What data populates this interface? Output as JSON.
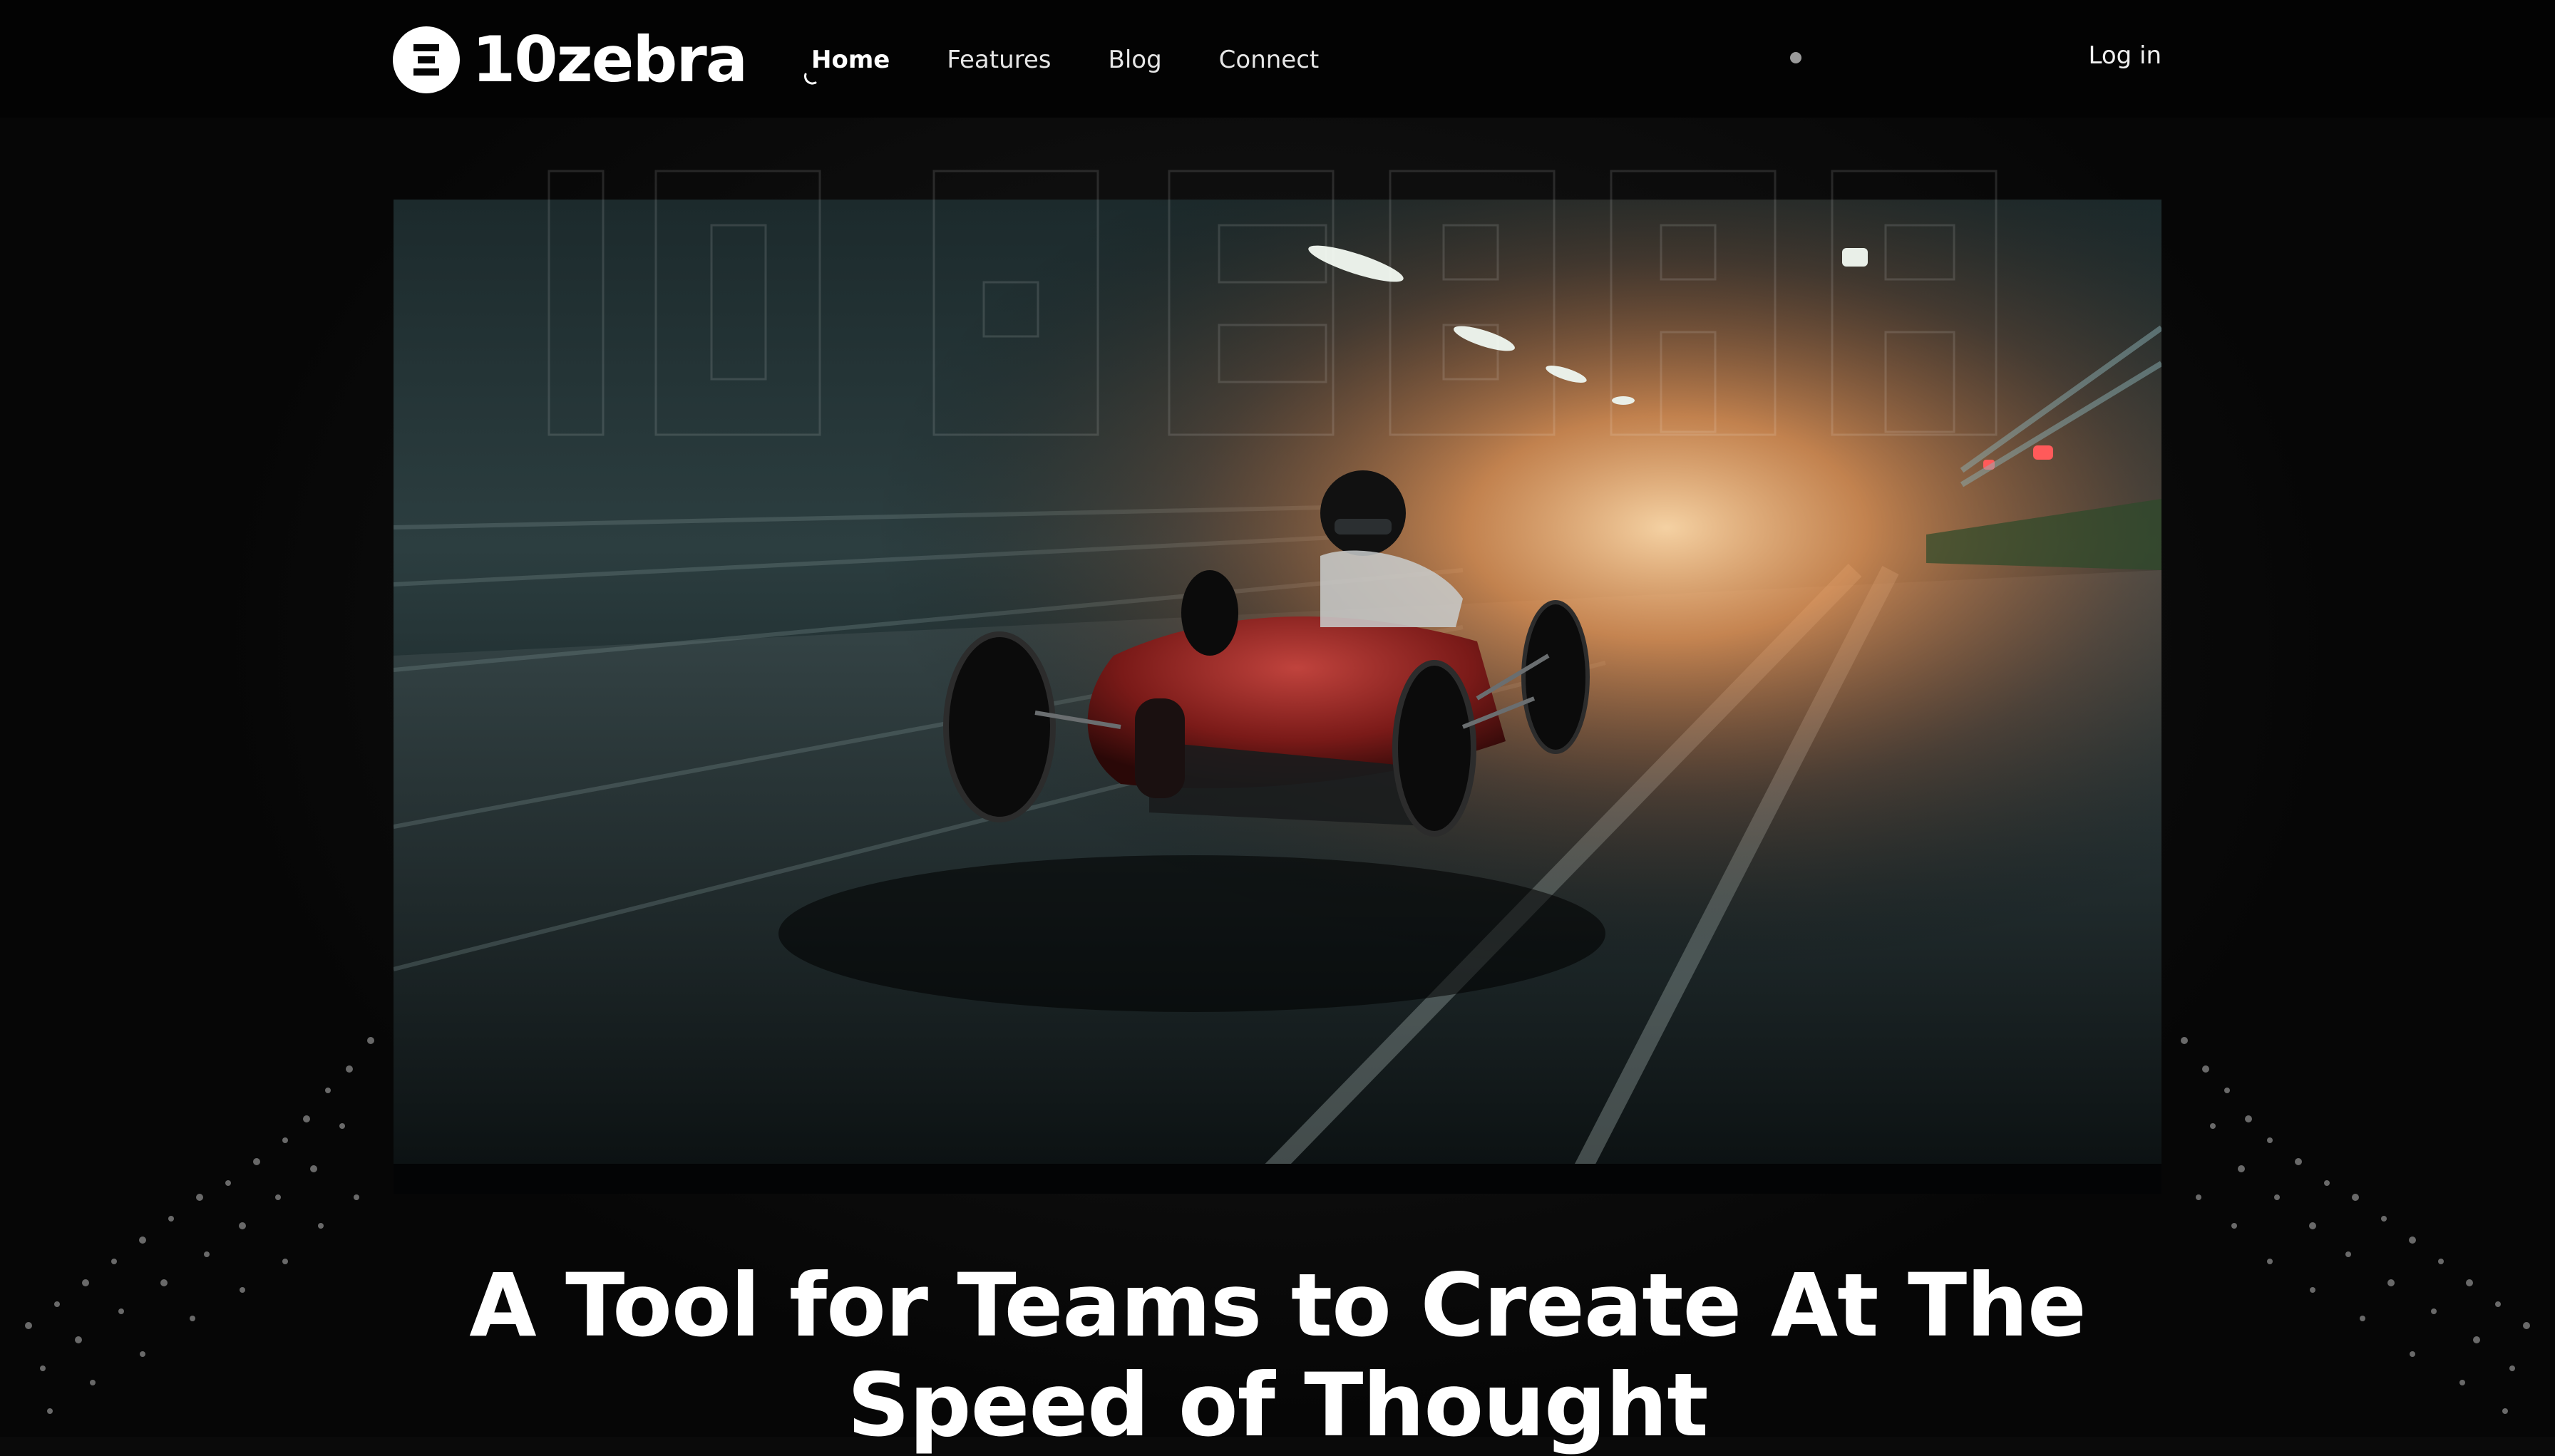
{
  "brand": {
    "name": "10zebra",
    "logo_icon": "zebra-logo-icon"
  },
  "nav": {
    "items": [
      {
        "label": "Home",
        "active": true
      },
      {
        "label": "Features",
        "active": false
      },
      {
        "label": "Blog",
        "active": false
      },
      {
        "label": "Connect",
        "active": false
      }
    ],
    "login_label": "Log in"
  },
  "hero": {
    "image_icon": "race-car-hero-image",
    "headline_line1": "A Tool for Teams to Create At The",
    "headline_line2": "Speed of Thought"
  },
  "colors": {
    "background": "#0a0a0a",
    "text": "#ffffff",
    "accent_glow": "#ff8a3d"
  }
}
